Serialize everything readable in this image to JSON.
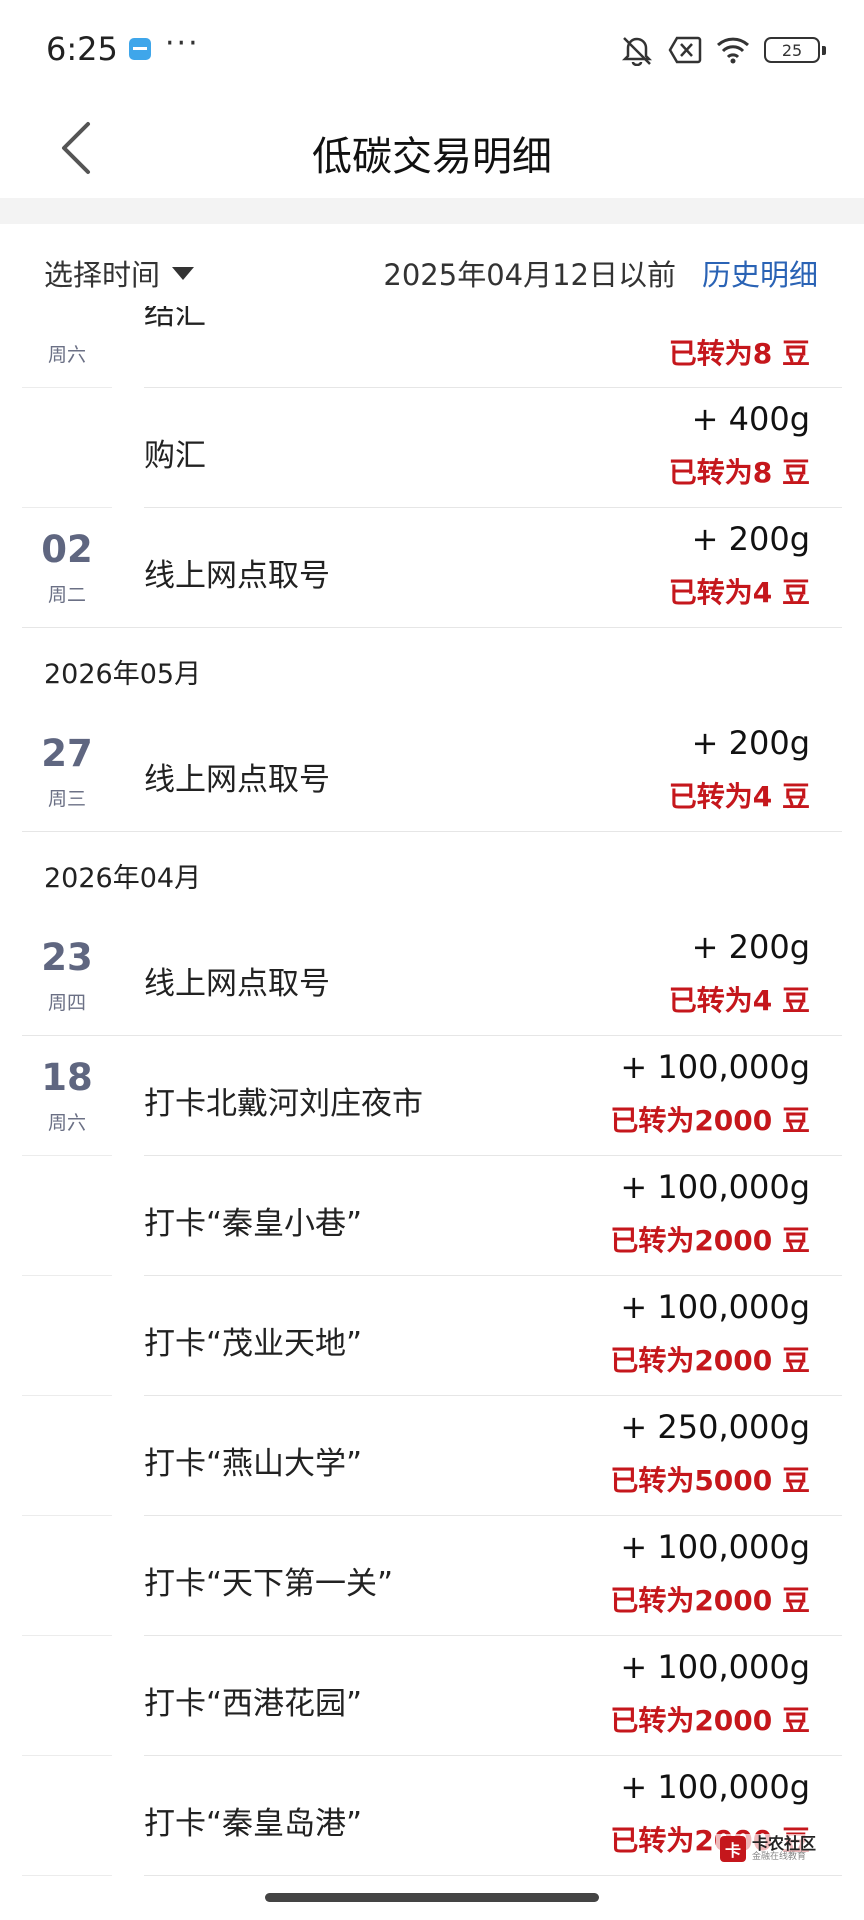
{
  "status_bar": {
    "time": "6:25",
    "dots": "···",
    "battery": "25"
  },
  "header": {
    "title": "低碳交易明细"
  },
  "filter": {
    "select_label": "选择时间",
    "date_before": "2025年04月12日以前",
    "history_link": "历史明细"
  },
  "list": {
    "first_cut": {
      "weekday": "周六",
      "name": "结汇",
      "beans": "已转为8 豆"
    },
    "rows": [
      {
        "kind": "tx",
        "day": "",
        "weekday": "",
        "name": "购汇",
        "amount": "+ 400g",
        "beans": "已转为8 豆",
        "line": "right"
      },
      {
        "kind": "tx",
        "day": "02",
        "weekday": "周二",
        "name": "线上网点取号",
        "amount": "+ 200g",
        "beans": "已转为4 豆",
        "line": "full"
      },
      {
        "kind": "month",
        "label": "2026年05月"
      },
      {
        "kind": "tx",
        "day": "27",
        "weekday": "周三",
        "name": "线上网点取号",
        "amount": "+ 200g",
        "beans": "已转为4 豆",
        "line": "full"
      },
      {
        "kind": "month",
        "label": "2026年04月"
      },
      {
        "kind": "tx",
        "day": "23",
        "weekday": "周四",
        "name": "线上网点取号",
        "amount": "+ 200g",
        "beans": "已转为4 豆",
        "line": "full"
      },
      {
        "kind": "tx",
        "day": "18",
        "weekday": "周六",
        "name": "打卡北戴河刘庄夜市",
        "amount": "+ 100,000g",
        "beans": "已转为2000 豆",
        "line": "right"
      },
      {
        "kind": "tx",
        "day": "",
        "weekday": "",
        "name": "打卡“秦皇小巷”",
        "amount": "+ 100,000g",
        "beans": "已转为2000 豆",
        "line": "right"
      },
      {
        "kind": "tx",
        "day": "",
        "weekday": "",
        "name": "打卡“茂业天地”",
        "amount": "+ 100,000g",
        "beans": "已转为2000 豆",
        "line": "right"
      },
      {
        "kind": "tx",
        "day": "",
        "weekday": "",
        "name": "打卡“燕山大学”",
        "amount": "+ 250,000g",
        "beans": "已转为5000 豆",
        "line": "right"
      },
      {
        "kind": "tx",
        "day": "",
        "weekday": "",
        "name": "打卡“天下第一关”",
        "amount": "+ 100,000g",
        "beans": "已转为2000 豆",
        "line": "right"
      },
      {
        "kind": "tx",
        "day": "",
        "weekday": "",
        "name": "打卡“西港花园”",
        "amount": "+ 100,000g",
        "beans": "已转为2000 豆",
        "line": "right"
      },
      {
        "kind": "tx",
        "day": "",
        "weekday": "",
        "name": "打卡“秦皇岛港”",
        "amount": "+ 100,000g",
        "beans": "已转为2000 豆",
        "line": "right"
      }
    ]
  },
  "watermark": {
    "mark": "卡",
    "title": "卡农社区",
    "subtitle": "金融在线教育"
  }
}
